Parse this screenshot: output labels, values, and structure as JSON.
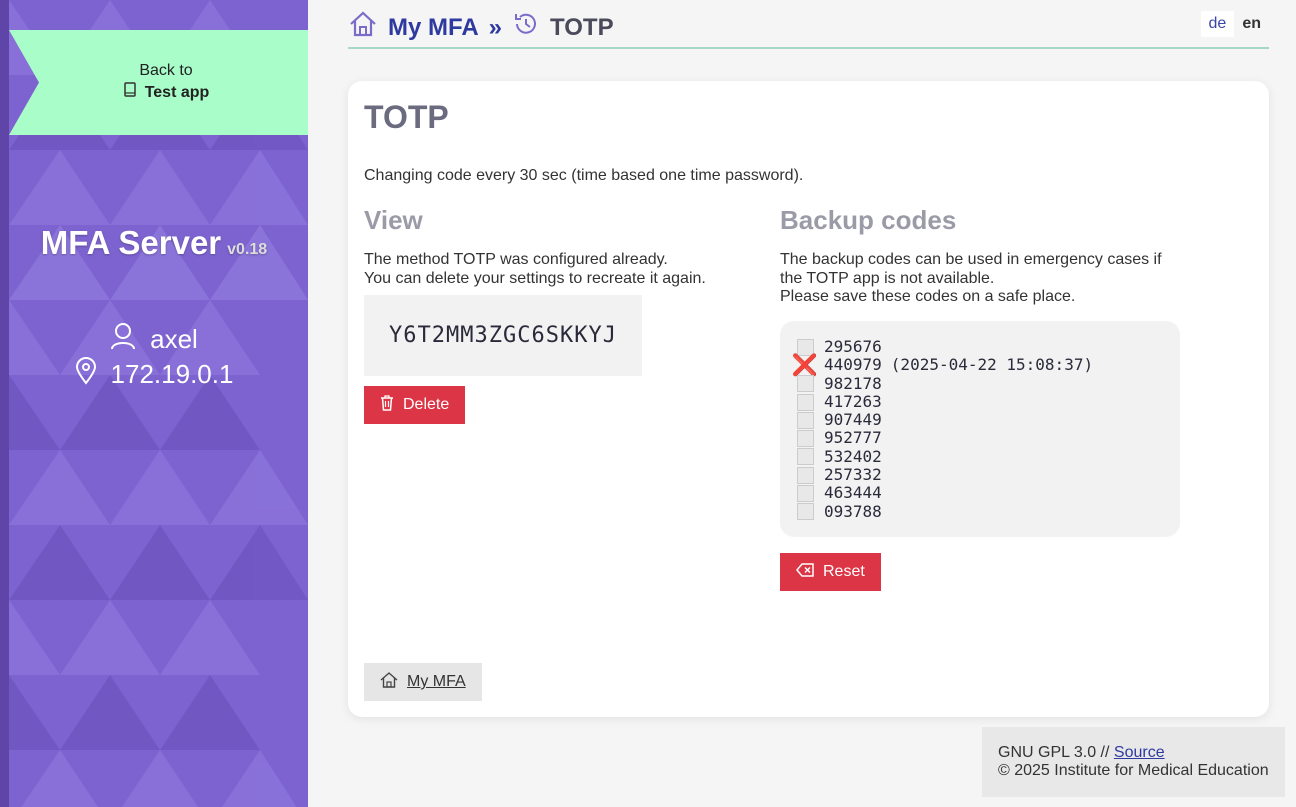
{
  "sidebar": {
    "back_prefix": "Back to",
    "back_app": "Test app",
    "server_name": "MFA Server",
    "server_version": "v0.18",
    "username": "axel",
    "ip": "172.19.0.1"
  },
  "header": {
    "home_label": "My MFA",
    "separator": "»",
    "current": "TOTP",
    "lang_de": "de",
    "lang_en": "en"
  },
  "card": {
    "title": "TOTP",
    "description": "Changing code every 30 sec (time based one time password).",
    "view": {
      "title": "View",
      "line1": "The method TOTP was configured already.",
      "line2": "You can delete your settings to recreate it again.",
      "secret": "Y6T2MM3ZGC6SKKYJ",
      "delete_label": "Delete"
    },
    "backup": {
      "title": "Backup codes",
      "line1": "The backup codes can be used in emergency cases if",
      "line2": "the TOTP app is not available.",
      "line3": "Please save these codes on a safe place.",
      "codes": [
        {
          "code": "295676",
          "used": false,
          "note": ""
        },
        {
          "code": "440979",
          "used": true,
          "note": "(2025-04-22 15:08:37)"
        },
        {
          "code": "982178",
          "used": false,
          "note": ""
        },
        {
          "code": "417263",
          "used": false,
          "note": ""
        },
        {
          "code": "907449",
          "used": false,
          "note": ""
        },
        {
          "code": "952777",
          "used": false,
          "note": ""
        },
        {
          "code": "532402",
          "used": false,
          "note": ""
        },
        {
          "code": "257332",
          "used": false,
          "note": ""
        },
        {
          "code": "463444",
          "used": false,
          "note": ""
        },
        {
          "code": "093788",
          "used": false,
          "note": ""
        }
      ],
      "reset_label": "Reset"
    },
    "my_mfa_label": "My MFA"
  },
  "footer": {
    "license": "GNU GPL 3.0 //",
    "source_label": "Source",
    "copyright": "© 2025 Institute for Medical Education"
  },
  "colors": {
    "sidebar_purple": "#7d63cf",
    "banner_green": "#a8fdc8",
    "danger_red": "#dc3545",
    "link_blue": "#2e3aa0"
  }
}
